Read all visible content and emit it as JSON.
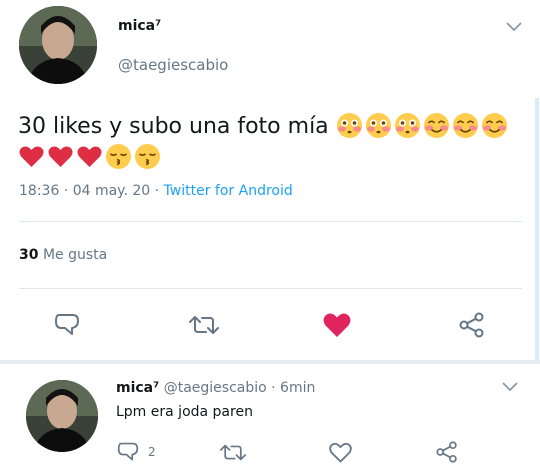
{
  "tweet": {
    "display_name": "mica⁷",
    "handle": "@taegiescabio",
    "text": "30 likes y subo una foto mía",
    "emojis_line1": [
      "flushed",
      "flushed",
      "flushed",
      "smiling-blush",
      "smiling-blush",
      "smiling-blush"
    ],
    "emojis_line2": [
      "red-heart",
      "red-heart",
      "red-heart",
      "kissing-closed-eyes",
      "kissing-closed-eyes"
    ],
    "timestamp": "18:36 · 04 may. 20 ·",
    "source": "Twitter for Android",
    "like_count": "30",
    "like_label": "Me gusta",
    "liked": true,
    "heart_color": "#e0245e"
  },
  "reply": {
    "display_name": "mica⁷",
    "handle": "@taegiescabio",
    "time": "· 6min",
    "text": "Lpm era joda paren",
    "reply_count": "2"
  },
  "colors": {
    "secondary_text": "#657786",
    "link": "#1da1f2",
    "divider": "#e1e8ed"
  },
  "icons": [
    "chevron-down-icon",
    "reply-icon",
    "retweet-icon",
    "heart-icon",
    "share-icon"
  ]
}
